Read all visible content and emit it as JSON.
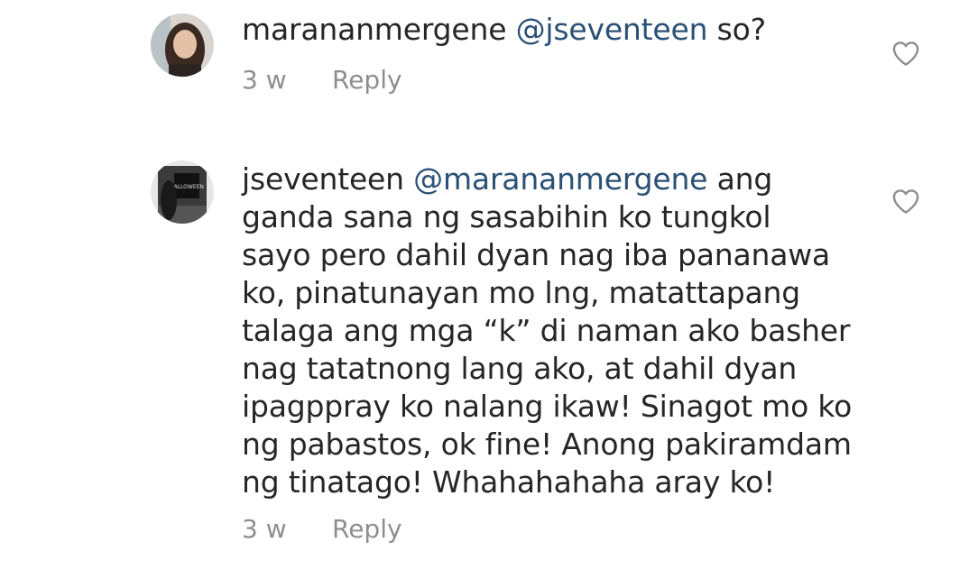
{
  "comments": [
    {
      "username": "marananmergene",
      "mention": "@jseventeen",
      "text_after_mention": " so?",
      "lines": [],
      "time": "3 w",
      "reply_label": "Reply",
      "like_icon": "heart-outline-icon"
    },
    {
      "username": "jseventeen",
      "mention": "@marananmergene",
      "text_after_mention": " ang",
      "lines": [
        "ganda sana ng sasabihin ko tungkol",
        "sayo pero dahil dyan nag iba pananawa",
        "ko, pinatunayan mo lng, matattapang",
        "talaga ang mga “k” di naman ako basher",
        "nag tatatnong lang ako, at dahil dyan",
        "ipagppray ko nalang ikaw!  Sinagot mo ko",
        "ng pabastos, ok fine! Anong pakiramdam",
        "ng tinatago! Whahahahaha aray ko!"
      ],
      "time": "3 w",
      "reply_label": "Reply",
      "like_icon": "heart-outline-icon"
    }
  ],
  "colors": {
    "username": "#262626",
    "mention": "#2b5176",
    "meta": "#8e8e8e"
  }
}
